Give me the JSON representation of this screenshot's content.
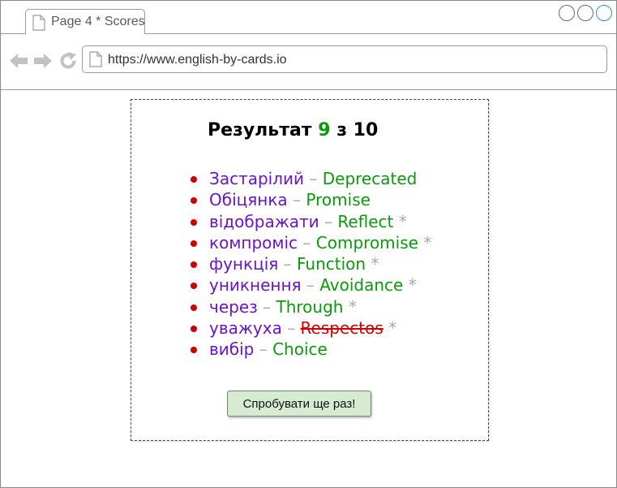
{
  "browser": {
    "tab_title": "Page 4 * Scores",
    "url": "https://www.english-by-cards.io"
  },
  "result": {
    "label": "Результат",
    "score": "9",
    "separator": "з",
    "total": "10"
  },
  "words": [
    {
      "ua": "Застарілий",
      "en": "Deprecated",
      "mark": "",
      "correct": true
    },
    {
      "ua": "Обіцянка",
      "en": "Promise",
      "mark": "",
      "correct": true
    },
    {
      "ua": "відображати",
      "en": "Reflect",
      "mark": "*",
      "correct": true
    },
    {
      "ua": "компроміс",
      "en": "Compromise",
      "mark": "*",
      "correct": true
    },
    {
      "ua": "функція",
      "en": "Function",
      "mark": "*",
      "correct": true
    },
    {
      "ua": "уникнення",
      "en": "Avoidance",
      "mark": "*",
      "correct": true
    },
    {
      "ua": "через",
      "en": "Through",
      "mark": "*",
      "correct": true
    },
    {
      "ua": "уважуха",
      "en": "Respectos",
      "mark": "*",
      "correct": false
    },
    {
      "ua": "вибір",
      "en": "Choice",
      "mark": "",
      "correct": true
    }
  ],
  "dash": "–",
  "retry_label": "Спробувати ще раз!",
  "colors": {
    "score": "#0a9a0a",
    "ukrainian": "#6a14c8",
    "english": "#0a9a0a",
    "wrong": "#d40000",
    "bullet": "#cc0000",
    "button": "#d6ebd2"
  },
  "icons": {
    "tab": "document-icon",
    "back": "back-arrow-icon",
    "forward": "forward-arrow-icon",
    "reload": "reload-icon",
    "url": "document-icon"
  }
}
